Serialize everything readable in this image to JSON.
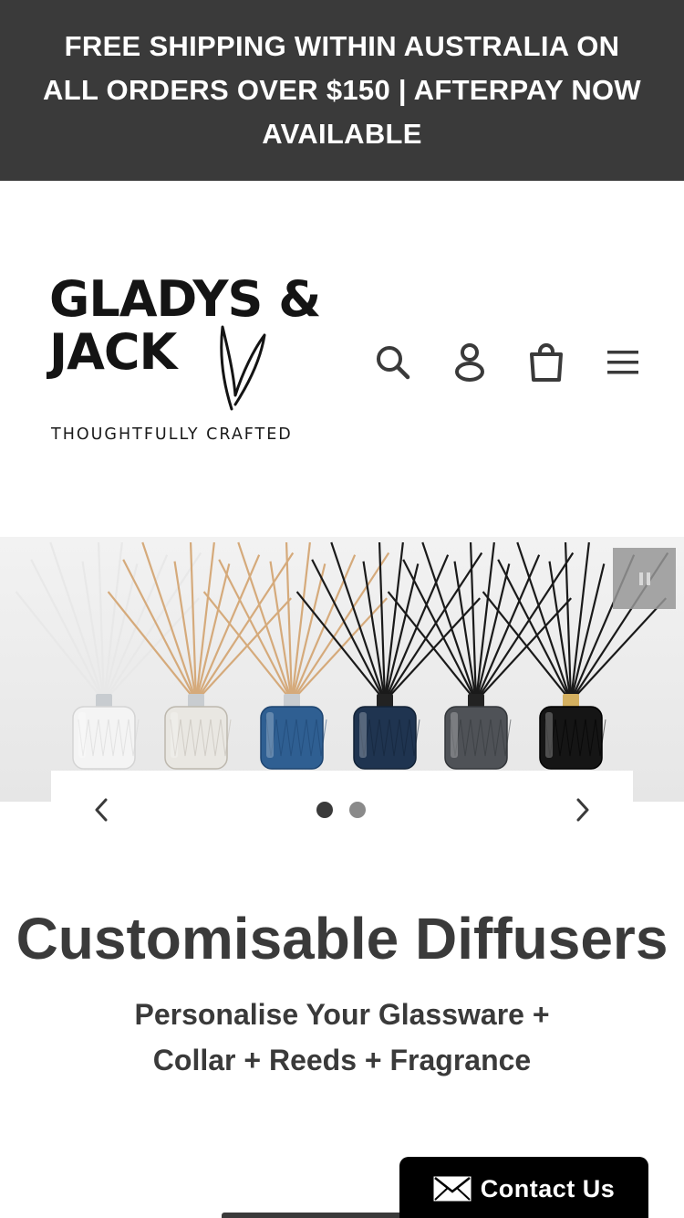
{
  "announcement": {
    "text": "FREE SHIPPING WITHIN AUSTRALIA ON ALL ORDERS OVER $150 | AFTERPAY NOW AVAILABLE"
  },
  "header": {
    "logo": {
      "line1": "GLADYS &",
      "line2": "JACK",
      "tagline": "THOUGHTFULLY CRAFTED"
    },
    "icons": [
      "search-icon",
      "account-icon",
      "cart-icon",
      "menu-icon"
    ]
  },
  "slideshow": {
    "current_slide": 1,
    "total_slides": 2,
    "pause_icon": "pause-icon",
    "prev_icon": "chevron-left-icon",
    "next_icon": "chevron-right-icon",
    "image": {
      "diffusers": [
        {
          "glass": "white",
          "reeds": "white",
          "collar": "silver"
        },
        {
          "glass": "clear",
          "reeds": "natural",
          "collar": "silver"
        },
        {
          "glass": "blue",
          "reeds": "natural",
          "collar": "silver"
        },
        {
          "glass": "navy",
          "reeds": "black",
          "collar": "black"
        },
        {
          "glass": "smoke",
          "reeds": "black",
          "collar": "black"
        },
        {
          "glass": "black",
          "reeds": "black",
          "collar": "gold"
        }
      ]
    }
  },
  "hero": {
    "title": "Customisable Diffusers",
    "subtitle": "Personalise Your Glassware + Collar + Reeds + Fragrance"
  },
  "contact": {
    "label": "Contact Us",
    "icon": "mail-icon"
  },
  "colors": {
    "dark": "#3a3a3a",
    "white": "#ffffff",
    "black": "#000000"
  }
}
